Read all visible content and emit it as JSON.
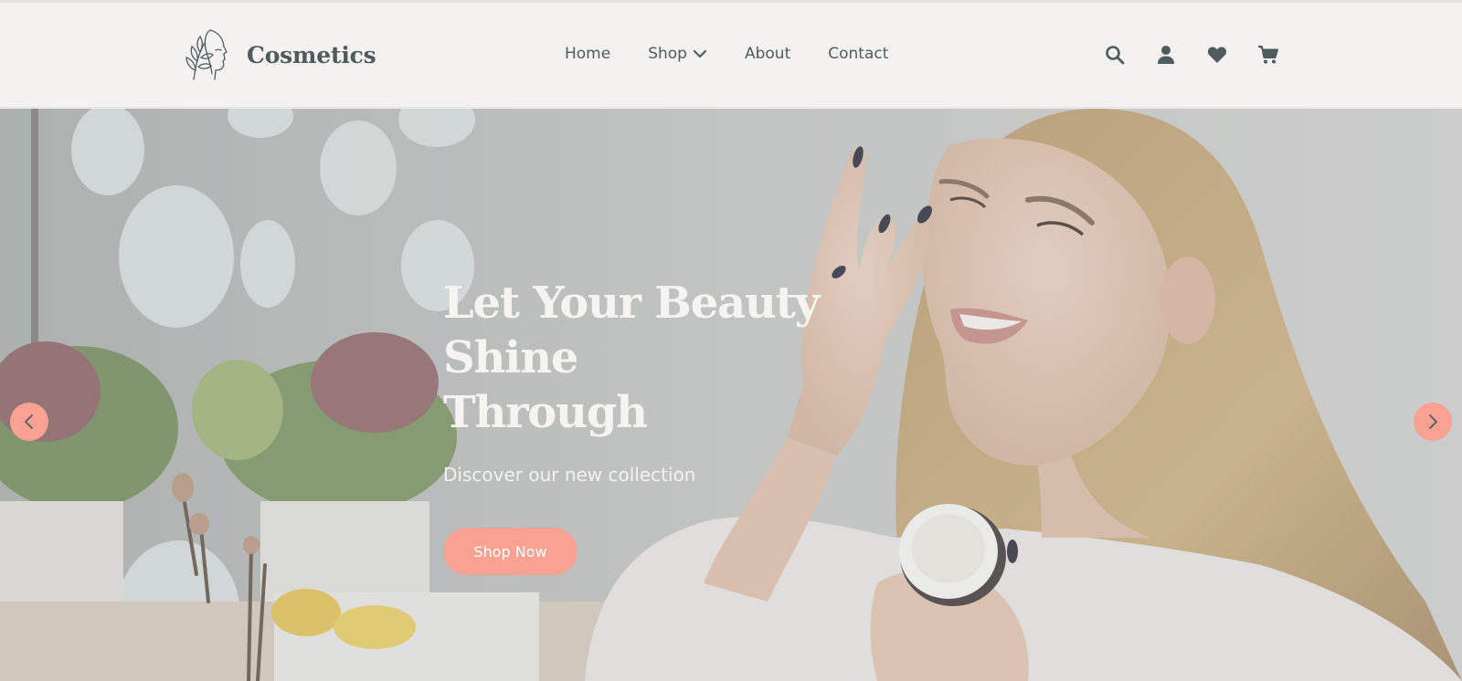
{
  "brand": {
    "name": "Cosmetics",
    "logo_icon": "woman-face-leaf-logo"
  },
  "nav": {
    "items": [
      {
        "label": "Home"
      },
      {
        "label": "Shop",
        "has_dropdown": true
      },
      {
        "label": "About"
      },
      {
        "label": "Contact"
      }
    ]
  },
  "header_icons": [
    "search-icon",
    "user-icon",
    "heart-icon",
    "cart-icon"
  ],
  "hero": {
    "title_line1": "Let Your Beauty Shine",
    "title_line2": "Through",
    "subtitle": "Discover our new collection",
    "cta_label": "Shop Now",
    "image_description_icon": "woman-applying-cream-photo"
  },
  "carousel": {
    "prev_icon": "chevron-left-icon",
    "next_icon": "chevron-right-icon"
  },
  "colors": {
    "accent": "#f9a193",
    "text": "#4e5c5e",
    "header_bg": "#f3f2f0",
    "hero_text": "#f6f4f1"
  }
}
